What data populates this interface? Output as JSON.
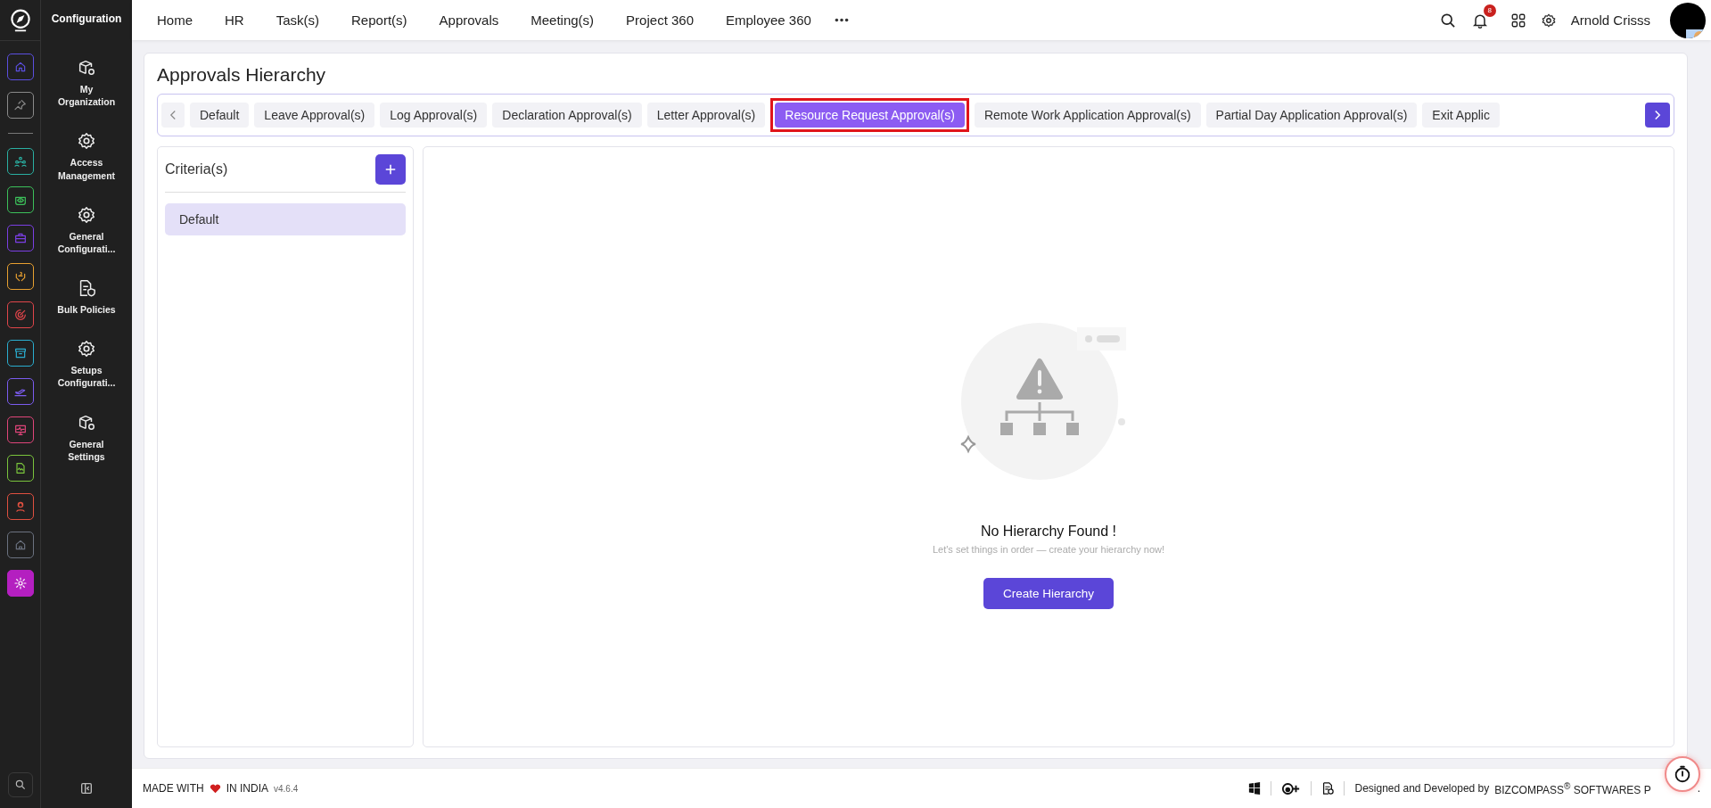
{
  "app": {
    "section_title": "Configuration"
  },
  "rail_items": [
    {
      "color": "#5b4fe0",
      "selected": false
    },
    {
      "color": "#8a8a8a",
      "selected": false
    },
    {
      "color": "#2ab0a2",
      "selected": false
    },
    {
      "color": "#3cc05a",
      "selected": false
    },
    {
      "color": "#7b3fe4",
      "selected": false
    },
    {
      "color": "#e8a030",
      "selected": false
    },
    {
      "color": "#e0454a",
      "selected": false
    },
    {
      "color": "#2aaed0",
      "selected": false
    },
    {
      "color": "#7b5cf0",
      "selected": false
    },
    {
      "color": "#e0457a",
      "selected": false
    },
    {
      "color": "#7ac43c",
      "selected": false
    },
    {
      "color": "#e05040",
      "selected": false
    },
    {
      "color": "#6b7280",
      "selected": false
    },
    {
      "color": "#b41fc0",
      "selected": true
    }
  ],
  "sidebar_items": [
    {
      "label": "My Organization"
    },
    {
      "label": "Access Management"
    },
    {
      "label": "General Configurati..."
    },
    {
      "label": "Bulk Policies"
    },
    {
      "label": "Setups Configurati..."
    },
    {
      "label": "General Settings"
    }
  ],
  "top_nav": [
    "Home",
    "HR",
    "Task(s)",
    "Report(s)",
    "Approvals",
    "Meeting(s)",
    "Project 360",
    "Employee 360"
  ],
  "notifications": {
    "count": "8"
  },
  "user": {
    "name": "Arnold Crisss"
  },
  "page": {
    "title": "Approvals Hierarchy"
  },
  "tabs": [
    {
      "label": "Default",
      "selected": false,
      "highlighted": false
    },
    {
      "label": "Leave Approval(s)",
      "selected": false,
      "highlighted": false
    },
    {
      "label": "Log Approval(s)",
      "selected": false,
      "highlighted": false
    },
    {
      "label": "Declaration Approval(s)",
      "selected": false,
      "highlighted": false
    },
    {
      "label": "Letter Approval(s)",
      "selected": false,
      "highlighted": false
    },
    {
      "label": "Resource Request Approval(s)",
      "selected": true,
      "highlighted": true
    },
    {
      "label": "Remote Work Application Approval(s)",
      "selected": false,
      "highlighted": false
    },
    {
      "label": "Partial Day Application Approval(s)",
      "selected": false,
      "highlighted": false
    },
    {
      "label": "Exit Applic",
      "selected": false,
      "highlighted": false
    }
  ],
  "criteria": {
    "title": "Criteria(s)",
    "items": [
      {
        "label": "Default",
        "selected": true
      }
    ]
  },
  "empty_state": {
    "title": "No Hierarchy Found !",
    "message": "Let's set things in order — create your hierarchy now!",
    "button": "Create Hierarchy"
  },
  "footer": {
    "made_with": "MADE WITH",
    "in_india": "IN INDIA",
    "version": "v4.6.4",
    "designed_by": "Designed and Developed by",
    "company": "BIZCOMPASS$^{®}$ SOFTWARES P",
    "tail": "."
  }
}
